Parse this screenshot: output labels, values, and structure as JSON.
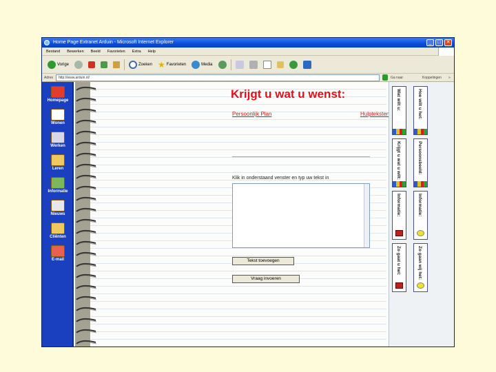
{
  "window": {
    "title": "Home Page Extranet Arduin - Microsoft Internet Explorer",
    "controls": [
      "_",
      "□",
      "✕"
    ]
  },
  "menubar": [
    "Bestand",
    "Bewerken",
    "Beeld",
    "Favorieten",
    "Extra",
    "Help"
  ],
  "toolbar": {
    "back": "Vorige",
    "search": "Zoeken",
    "favorites": "Favorieten",
    "media": "Media"
  },
  "address": {
    "label": "Adres",
    "value": "http://www.arduin.nl/",
    "go": "Ga naar",
    "links": "Koppelingen"
  },
  "sidebar": {
    "items": [
      {
        "label": "Homepage"
      },
      {
        "label": "Wonen"
      },
      {
        "label": "Werken"
      },
      {
        "label": "Leren"
      },
      {
        "label": "Informatie"
      },
      {
        "label": "Nieuws"
      },
      {
        "label": "Cliënten"
      },
      {
        "label": "E-mail"
      }
    ]
  },
  "main": {
    "heading": "Krijgt u wat u wenst:",
    "link_left": "Persoonlijk Plan",
    "link_right": "Hulpteksten",
    "instruction": "Klik in onderstaand venster en typ uw tekst in",
    "button_top": "Tekst toevoegen",
    "button_bottom": "Vraag invoeren"
  },
  "tabs": [
    {
      "label": "Wat wilt u:"
    },
    {
      "label": "Hoe wilt u het:"
    },
    {
      "label": "Krijgt u wat u wilt:"
    },
    {
      "label": "Persoonsbeeld:"
    },
    {
      "label": "Informatie:"
    },
    {
      "label": "Informatie:"
    },
    {
      "label": "Zo gaat u het:"
    },
    {
      "label": "Zo gaan wij het:"
    }
  ],
  "colors": {
    "heading": "#e0101c",
    "sidebar": "#1a3fbf",
    "page_bg": "#fdfbd9"
  }
}
